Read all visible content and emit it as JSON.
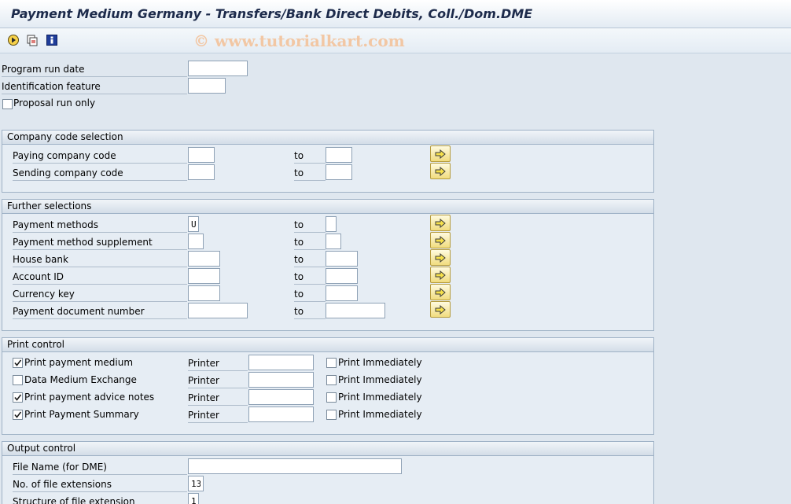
{
  "window": {
    "title": "Payment Medium Germany - Transfers/Bank Direct Debits, Coll./Dom.DME"
  },
  "toolbar": {
    "icons": [
      "execute-icon",
      "variants-icon",
      "info-icon"
    ],
    "watermark": "© www.tutorialkart.com"
  },
  "top_fields": {
    "program_run_date": {
      "label": "Program run date",
      "value": ""
    },
    "identification_feature": {
      "label": "Identification feature",
      "value": ""
    },
    "proposal_run_only": {
      "label": "Proposal run only",
      "checked": false
    }
  },
  "company_code": {
    "header": "Company code selection",
    "rows": [
      {
        "label": "Paying company code",
        "from": "",
        "to_label": "to",
        "to": ""
      },
      {
        "label": "Sending company code",
        "from": "",
        "to_label": "to",
        "to": ""
      }
    ]
  },
  "further": {
    "header": "Further selections",
    "rows": [
      {
        "label": "Payment methods",
        "from": "U",
        "to_label": "to",
        "to": ""
      },
      {
        "label": "Payment method supplement",
        "from": "",
        "to_label": "to",
        "to": ""
      },
      {
        "label": "House bank",
        "from": "",
        "to_label": "to",
        "to": ""
      },
      {
        "label": "Account ID",
        "from": "",
        "to_label": "to",
        "to": ""
      },
      {
        "label": "Currency key",
        "from": "",
        "to_label": "to",
        "to": ""
      },
      {
        "label": "Payment document number",
        "from": "",
        "to_label": "to",
        "to": ""
      }
    ]
  },
  "print_control": {
    "header": "Print control",
    "printer_label": "Printer",
    "immediately_label": "Print Immediately",
    "rows": [
      {
        "label": "Print payment medium",
        "checked": true,
        "printer": "",
        "immediately": false
      },
      {
        "label": "Data Medium Exchange",
        "checked": false,
        "printer": "",
        "immediately": false
      },
      {
        "label": "Print payment advice notes",
        "checked": true,
        "printer": "",
        "immediately": false
      },
      {
        "label": "Print Payment Summary",
        "checked": true,
        "printer": "",
        "immediately": false
      }
    ]
  },
  "output_control": {
    "header": "Output control",
    "file_name": {
      "label": "File Name (for DME)",
      "value": ""
    },
    "file_extensions": {
      "label": "No. of file extensions",
      "value": "13"
    },
    "structure": {
      "label": "Structure of file extension",
      "value": "1"
    }
  }
}
